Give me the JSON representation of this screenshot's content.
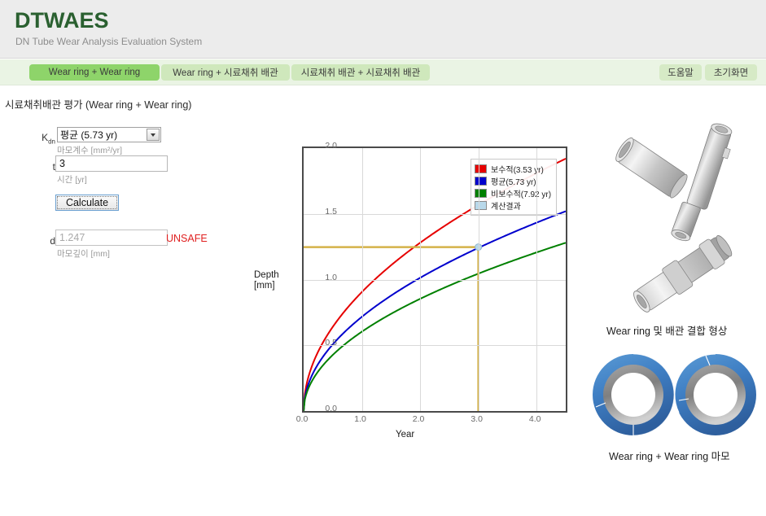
{
  "header": {
    "title": "DTWAES",
    "subtitle": "DN Tube Wear Analysis Evaluation System"
  },
  "tabs": [
    {
      "label": "Wear ring + Wear ring",
      "active": true
    },
    {
      "label": "Wear ring + 시료채취 배관",
      "active": false
    },
    {
      "label": "시료채취 배관 + 시료채취 배관",
      "active": false
    }
  ],
  "top_buttons": {
    "help": "도움말",
    "home": "초기화면"
  },
  "page_title": "시료채취배관 평가 (Wear ring + Wear ring)",
  "form": {
    "k_label": "K",
    "k_sub": "dn",
    "k_value": "평균 (5.73 yr)",
    "k_options": [
      "보수적 (3.53 yr)",
      "평균 (5.73 yr)",
      "비보수적 (7.92 yr)"
    ],
    "k_unit": "마모계수 [mm²/yr]",
    "t_label": "t",
    "t_value": "3",
    "t_placeholder": "",
    "t_unit": "시간 [yr]",
    "calculate_label": "Calculate",
    "d_label": "d",
    "d_value": "1.247",
    "d_unit": "마모깊이 [mm]",
    "status": "UNSAFE",
    "status_color": "#e02020"
  },
  "chart_data": {
    "type": "line",
    "title": "",
    "xlabel": "Year",
    "ylabel": "Depth\n[mm]",
    "xlim": [
      0.0,
      4.5
    ],
    "ylim": [
      0.0,
      2.0
    ],
    "xticks": [
      "0.0",
      "1.0",
      "2.0",
      "3.0",
      "4.0"
    ],
    "xtick_values": [
      0.0,
      1.0,
      2.0,
      3.0,
      4.0
    ],
    "yticks": [
      "0.0",
      "0.5",
      "1.0",
      "1.5",
      "2.0"
    ],
    "ytick_values": [
      0.0,
      0.5,
      1.0,
      1.5,
      2.0
    ],
    "grid": true,
    "legend_position": "top-right",
    "series": [
      {
        "name": "보수적(3.53 yr)",
        "color": "#e60000",
        "x": [
          0.0,
          0.1,
          0.25,
          0.5,
          0.75,
          1.0,
          1.5,
          2.0,
          2.5,
          3.0,
          3.5,
          4.0,
          4.5
        ],
        "y": [
          0.0,
          0.29,
          0.46,
          0.64,
          0.79,
          0.91,
          1.11,
          1.29,
          1.43,
          1.55,
          1.68,
          1.8,
          1.92
        ]
      },
      {
        "name": "평균(5.73 yr)",
        "color": "#0000cd",
        "x": [
          0.0,
          0.1,
          0.25,
          0.5,
          0.75,
          1.0,
          1.5,
          2.0,
          2.5,
          3.0,
          3.5,
          4.0,
          4.5
        ],
        "y": [
          0.0,
          0.23,
          0.37,
          0.51,
          0.63,
          0.72,
          0.88,
          1.02,
          1.13,
          1.247,
          1.34,
          1.43,
          1.52
        ]
      },
      {
        "name": "비보수적(7.92 yr)",
        "color": "#008000",
        "x": [
          0.0,
          0.1,
          0.25,
          0.5,
          0.75,
          1.0,
          1.5,
          2.0,
          2.5,
          3.0,
          3.5,
          4.0,
          4.5
        ],
        "y": [
          0.0,
          0.19,
          0.31,
          0.43,
          0.53,
          0.61,
          0.75,
          0.86,
          0.96,
          1.05,
          1.13,
          1.21,
          1.28
        ]
      }
    ],
    "legend_entries": [
      {
        "label": "보수적(3.53 yr)",
        "color": "#e60000"
      },
      {
        "label": "평균(5.73 yr)",
        "color": "#0000cd"
      },
      {
        "label": "비보수적(7.92 yr)",
        "color": "#008000"
      },
      {
        "label": "계산결과",
        "color": "#b8d8ea"
      }
    ],
    "marker": {
      "label": "계산결과",
      "x": 3.0,
      "y": 1.247,
      "color": "#b8d8ea",
      "guide_color": "#d4b24a"
    }
  },
  "figures": {
    "tube_caption": "Wear ring 및 배관 결합 형상",
    "ring_caption": "Wear ring + Wear ring  마모"
  }
}
